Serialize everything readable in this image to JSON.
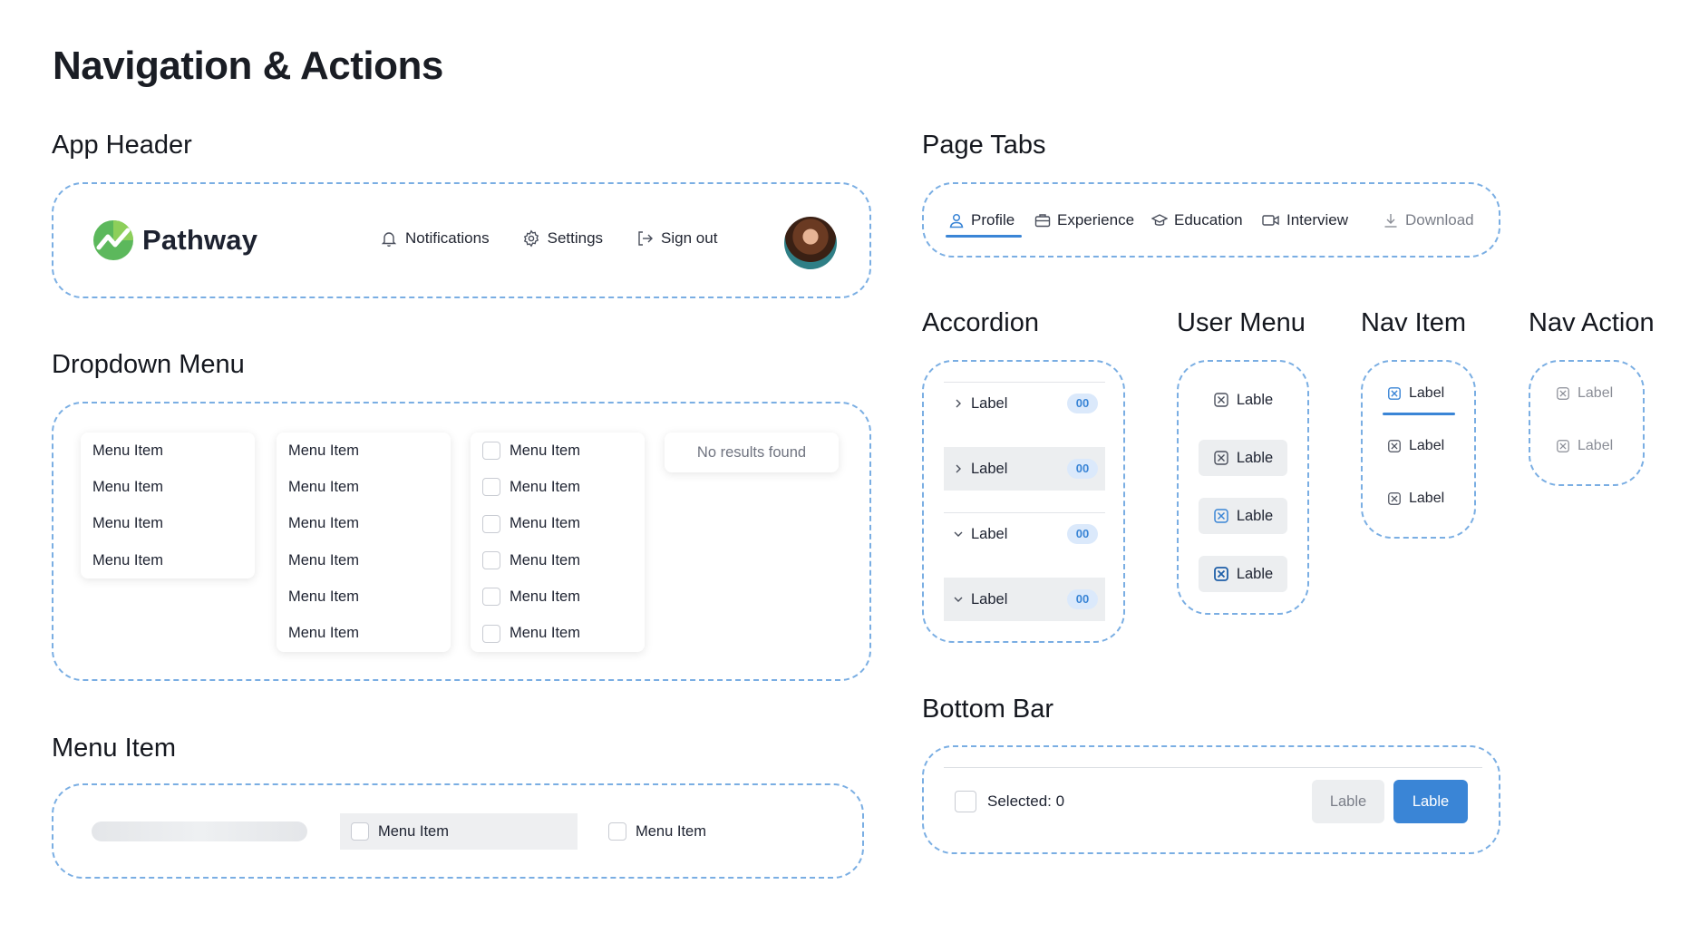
{
  "page_title": "Navigation & Actions",
  "colors": {
    "accent": "#3a85d6",
    "frame_border": "#7aaee3",
    "badge_bg": "#dbe9fb",
    "hover_bg": "#eceef0"
  },
  "sections": {
    "app_header": "App Header",
    "dropdown_menu": "Dropdown Menu",
    "menu_item": "Menu Item",
    "page_tabs": "Page Tabs",
    "accordion": "Accordion",
    "user_menu": "User Menu",
    "nav_item": "Nav Item",
    "nav_action": "Nav Action",
    "bottom_bar": "Bottom Bar"
  },
  "app_header": {
    "brand": "Pathway",
    "links": [
      {
        "label": "Notifications",
        "icon": "bell-icon"
      },
      {
        "label": "Settings",
        "icon": "gear-icon"
      },
      {
        "label": "Sign out",
        "icon": "sign-out-icon"
      }
    ],
    "avatar": "user-avatar"
  },
  "dropdown_menu": {
    "menu1": [
      "Menu Item",
      "Menu Item",
      "Menu Item",
      "Menu Item"
    ],
    "menu2": [
      "Menu Item",
      "Menu Item",
      "Menu Item",
      "Menu Item",
      "Menu Item",
      "Menu Item"
    ],
    "menu3": [
      "Menu Item",
      "Menu Item",
      "Menu Item",
      "Menu Item",
      "Menu Item",
      "Menu Item"
    ],
    "empty": "No results found"
  },
  "menu_item": {
    "hover_label": "Menu Item",
    "default_label": "Menu Item"
  },
  "page_tabs": [
    {
      "label": "Profile",
      "icon": "user-icon",
      "state": "active"
    },
    {
      "label": "Experience",
      "icon": "briefcase-icon",
      "state": "default"
    },
    {
      "label": "Education",
      "icon": "graduation-cap-icon",
      "state": "default"
    },
    {
      "label": "Interview",
      "icon": "video-icon",
      "state": "default"
    },
    {
      "label": "Download",
      "icon": "download-icon",
      "state": "disabled"
    }
  ],
  "accordion": [
    {
      "label": "Label",
      "badge": "00",
      "state": "collapsed"
    },
    {
      "label": "Label",
      "badge": "00",
      "state": "collapsed-hover"
    },
    {
      "label": "Label",
      "badge": "00",
      "state": "expanded"
    },
    {
      "label": "Label",
      "badge": "00",
      "state": "expanded-hover"
    }
  ],
  "user_menu": [
    "Lable",
    "Lable",
    "Lable",
    "Lable"
  ],
  "nav_item": [
    "Label",
    "Label",
    "Label"
  ],
  "nav_action": [
    "Label",
    "Label"
  ],
  "bottom_bar": {
    "selected_text": "Selected: 0",
    "secondary_label": "Lable",
    "primary_label": "Lable"
  }
}
